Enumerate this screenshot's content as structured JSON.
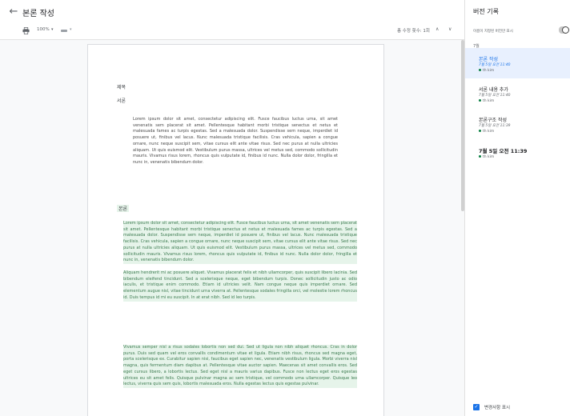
{
  "header": {
    "back_icon": "arrow-left-icon",
    "title": "본론 작성"
  },
  "toolbar": {
    "print_icon": "print-icon",
    "zoom": "100%",
    "zoom_caret": "▾",
    "tool_caret": "▾",
    "edit_count": "총 수정 횟수: 1회",
    "nav_up": "∧",
    "nav_down": "∨"
  },
  "document": {
    "title_heading": "제목",
    "intro_heading": "서론",
    "intro_text": "Lorem ipsum dolor sit amet, consectetur adipiscing elit. Fusce faucibus luctus urna, sit amet venenatis sem placerat sit amet. Pellentesque habitant morbi tristique senectus et netus et malesuada fames ac turpis egestas. Sed a malesuada dolor. Suspendisse sem neque, imperdiet id posuere ut, finibus vel lacus. Nunc malesuada tristique facilisis. Cras vehicula, sapien a congue ornare, nunc neque suscipit sem, vitae cursus elit ante vitae risus. Sed nec purus at nulla ultricies aliquam. Ut quis euismod elit. Vestibulum purus massa, ultrices vel metus sed, commodo sollicitudin mauris. Vivamus risus lorem, rhoncus quis vulputate id, finibus id nunc. Nulla dolor dolor, fringilla et nunc in, venenatis bibendum dolor.",
    "body_heading": "본론",
    "body_para1": "Lorem ipsum dolor sit amet, consectetur adipiscing elit. Fusce faucibus luctus urna, sit amet venenatis sem placerat sit amet. Pellentesque habitant morbi tristique senectus et netus et malesuada fames ac turpis egestas. Sed a malesuada dolor. Suspendisse sem neque, imperdiet id posuere ut, finibus vel lacus. Nunc malesuada tristique facilisis. Cras vehicula, sapien a congue ornare, nunc neque suscipit sem, vitae cursus elit ante vitae risus. Sed nec purus at nulla ultricies aliquam. Ut quis euismod elit. Vestibulum purus massa, ultrices vel metus sed, commodo sollicitudin mauris. Vivamus risus lorem, rhoncus quis vulputate id, finibus id nunc. Nulla dolor dolor, fringilla et nunc in, venenatis bibendum dolor.",
    "body_para2": "Aliquam hendrerit mi ac posuere aliquet. Vivamus placerat felis et nibh ullamcorper, quis suscipit libero lacinia. Sed bibendum eleifend tincidunt. Sed a scelerisque neque, eget bibendum turpis. Donec sollicitudin justo ac odio iaculis, et tristique enim commodo. Etiam id ultricies velit. Nam congue neque quis imperdiet ornare. Sed elementum augue nisl, vitae tincidunt urna viverra at. Pellentesque sodales fringilla orci, vel molestie lorem rhoncus id. Duis tempus id mi eu suscipit. In at erat nibh. Sed id leo turpis.",
    "body_para3": "Vivamus semper nisl a risus sodales lobortis non sed dui. Sed ut ligula non nibh aliquet rhoncus. Cras in dolor purus. Duis sed quam vel eros convallis condimentum vitae et ligula. Etiam nibh risus, rhoncus sed magna eget, porta scelerisque ex. Curabitur sapien nisi, faucibus eget sapien nec, venenatis vestibulum ligula. Morbi viverra nisl magna, quis fermentum diam dapibus at. Pellentesque vitae auctor sapien. Maecenas sit amet convallis eros. Sed eget cursus libero, a lobortis lectus. Sed eget nisl a mauris varius dapibus. Fusce non lectus eget eros egestas ultrices eu sit amet felis. Quisque pulvinar magna ac sem tristique, vel commodo urna ullamcorper. Quisque leo lectus, viverra quis sem quis, lobortis malesuada eros. Nulla egestas lectus quis egestas pulvinar."
  },
  "panel": {
    "title": "버전 기록",
    "filter_label": "이름이 지정된 버전만 표시",
    "group_label": "7월",
    "versions": [
      {
        "name": "본론 작성",
        "time": "7월 5일 오전 11:40",
        "author": "th kim"
      },
      {
        "name": "서론 내용 추가",
        "time": "7월 5일 오전 11:40",
        "author": "th kim"
      },
      {
        "name": "본론구조 작성",
        "time": "7월 5일 오전 11:39",
        "author": "th kim"
      },
      {
        "name": "7월 5일 오전 11:39",
        "author": "th kim"
      }
    ],
    "show_changes_label": "변경사항 표시",
    "checkmark": "✓"
  },
  "colors": {
    "accent": "#1a73e8",
    "highlight": "#e6f4ea",
    "author_dot": "#0b8043",
    "selected_bg": "#e8f0fe"
  }
}
